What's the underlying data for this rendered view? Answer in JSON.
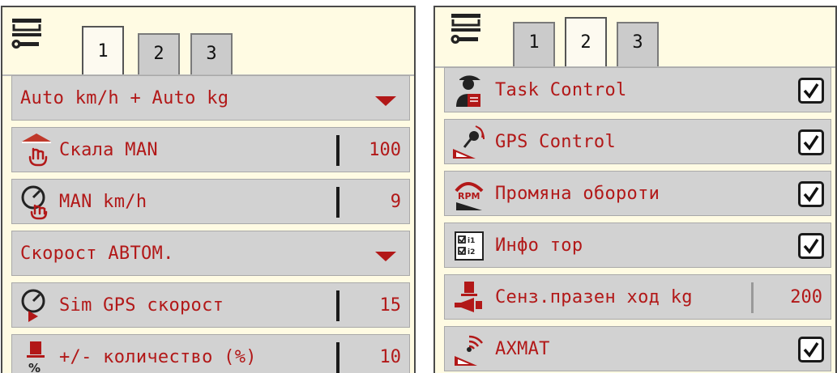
{
  "left_panel": {
    "tabs": [
      {
        "label": "1",
        "active": true
      },
      {
        "label": "2",
        "active": false
      },
      {
        "label": "3",
        "active": false
      }
    ],
    "rows": [
      {
        "label": "Auto km/h + Auto kg",
        "control": "dropdown"
      },
      {
        "label": "Скала MAN",
        "value": "100",
        "icon": "manual-scale-hand-icon"
      },
      {
        "label": "MAN km/h",
        "value": "9",
        "icon": "speedometer-hand-icon"
      },
      {
        "label": "Скорост АВТОМ.",
        "control": "dropdown"
      },
      {
        "label": "Sim GPS скорост",
        "value": "15",
        "icon": "speedometer-play-icon"
      },
      {
        "label": "+/- количество (%)",
        "value": "10",
        "icon": "weight-percent-icon"
      }
    ]
  },
  "right_panel": {
    "tabs": [
      {
        "label": "1",
        "active": false
      },
      {
        "label": "2",
        "active": true
      },
      {
        "label": "3",
        "active": false
      }
    ],
    "rows": [
      {
        "label": "Task Control",
        "checked": true,
        "icon": "farmer-tablet-icon"
      },
      {
        "label": "GPS Control",
        "checked": true,
        "icon": "gps-satellite-icon"
      },
      {
        "label": "Промяна обороти",
        "checked": true,
        "icon": "rpm-change-icon"
      },
      {
        "label": "Инфо тор",
        "checked": true,
        "icon": "info-checklist-icon"
      },
      {
        "label": "Сенз.празен ход kg",
        "value": "200",
        "icon": "weight-horn-sensor-icon"
      },
      {
        "label": "AXMAT",
        "checked": true,
        "icon": "axmat-signal-icon"
      }
    ]
  },
  "icons": {
    "header": "settings-menu-wrench-icon",
    "dropdown": "dropdown-arrow-icon",
    "checkbox": "checkmark-icon"
  },
  "colors": {
    "panel_background": "#fffbe3",
    "row_background": "#d2d2d2",
    "accent_red": "#b21818",
    "tab_inactive": "#cbcbcb"
  }
}
